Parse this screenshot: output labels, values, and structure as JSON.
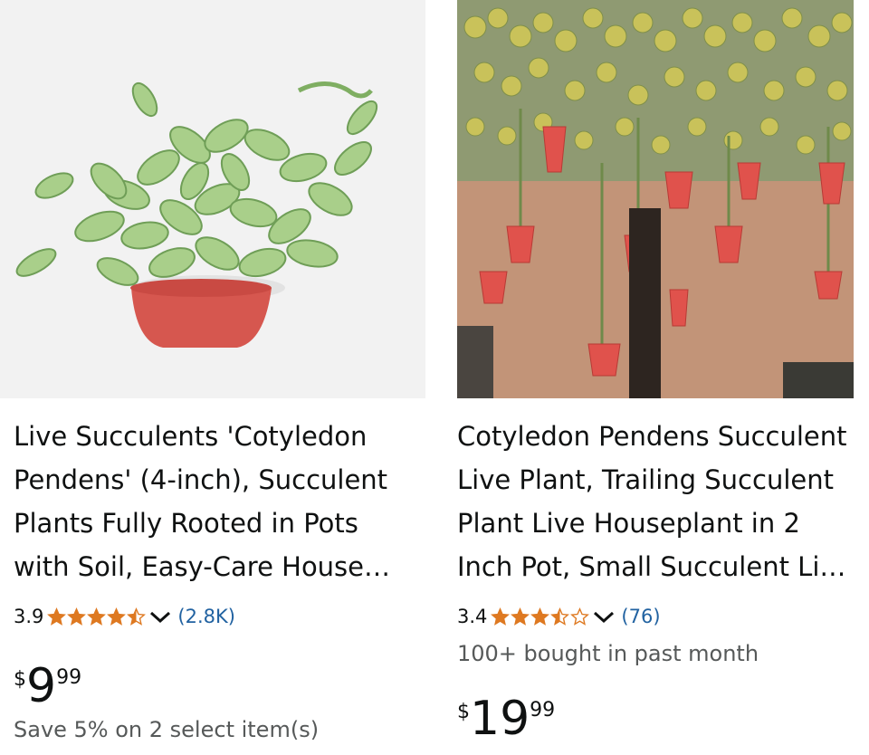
{
  "products": [
    {
      "title": "Live Succulents 'Cotyledon Pendens' (4-inch), Succulent Plants Fully Rooted in Pots with Soil, Easy-Care House Plants",
      "rating": "3.9",
      "stars": [
        1,
        1,
        1,
        1,
        0.5
      ],
      "review_count": "(2.8K)",
      "price_symbol": "$",
      "price_whole": "9",
      "price_fraction": "99",
      "promo": "Save 5% on 2 select item(s)",
      "image_icon": "succulent-in-red-pot"
    },
    {
      "title": "Cotyledon Pendens Succulent Live Plant, Trailing Succulent Plant Live Houseplant in 2 Inch Pot, Small Succulent Live Plant",
      "rating": "3.4",
      "stars": [
        1,
        1,
        1,
        0.5,
        0
      ],
      "review_count": "(76)",
      "bought": "100+ bought in past month",
      "price_symbol": "$",
      "price_whole": "19",
      "price_fraction": "99",
      "image_icon": "trailing-succulent-with-flowers"
    }
  ],
  "colors": {
    "star": "#de7921",
    "link": "#2162a1",
    "secondary_text": "#565959"
  }
}
